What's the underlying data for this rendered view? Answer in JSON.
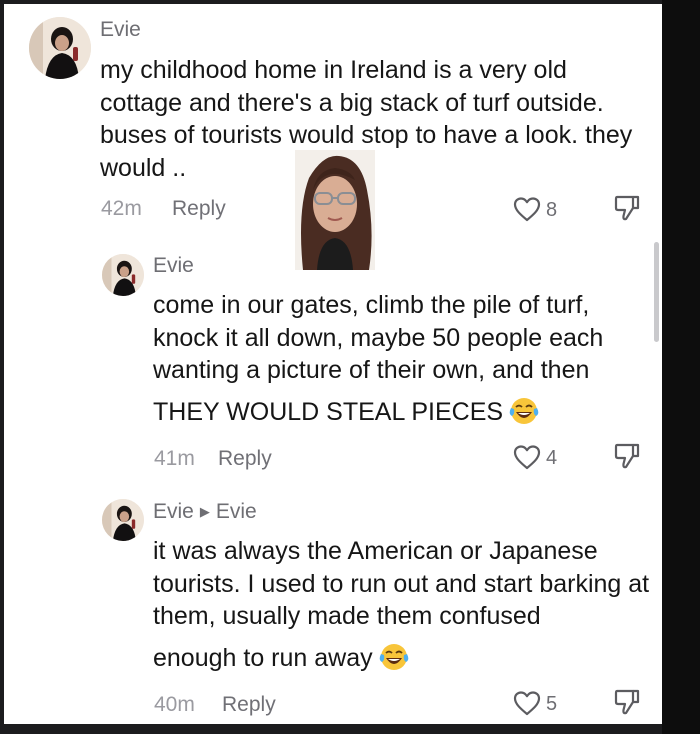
{
  "comments": [
    {
      "author": "Evie",
      "text": "my childhood home in Ireland is a very old cottage and there's a big stack of turf outside. buses of tourists would stop to have a look. they would ..",
      "time": "42m",
      "reply_label": "Reply",
      "likes": "8",
      "avatar_icon": "avatar-photo"
    },
    {
      "author": "Evie",
      "text": "come in our gates, climb the pile of turf, knock it all down, maybe 50 people each wanting a picture of their own, and then",
      "text2": "THEY WOULD STEAL PIECES",
      "time": "41m",
      "reply_label": "Reply",
      "likes": "4",
      "emoji": "tears-of-joy-emoji"
    },
    {
      "author": "Evie",
      "reply_to": "Evie",
      "text": "it was always the American or Japanese tourists. I used to run out and start barking at them, usually made them confused",
      "text2": "enough to run away",
      "time": "40m",
      "reply_label": "Reply",
      "likes": "5",
      "emoji": "tears-of-joy-emoji"
    }
  ],
  "icons": {
    "like": "heart-outline-icon",
    "dislike": "thumbs-down-icon",
    "reply_arrow": "triangle-right-icon"
  },
  "colors": {
    "text": "#161616",
    "muted": "#9a9aa0",
    "background": "#ffffff"
  }
}
